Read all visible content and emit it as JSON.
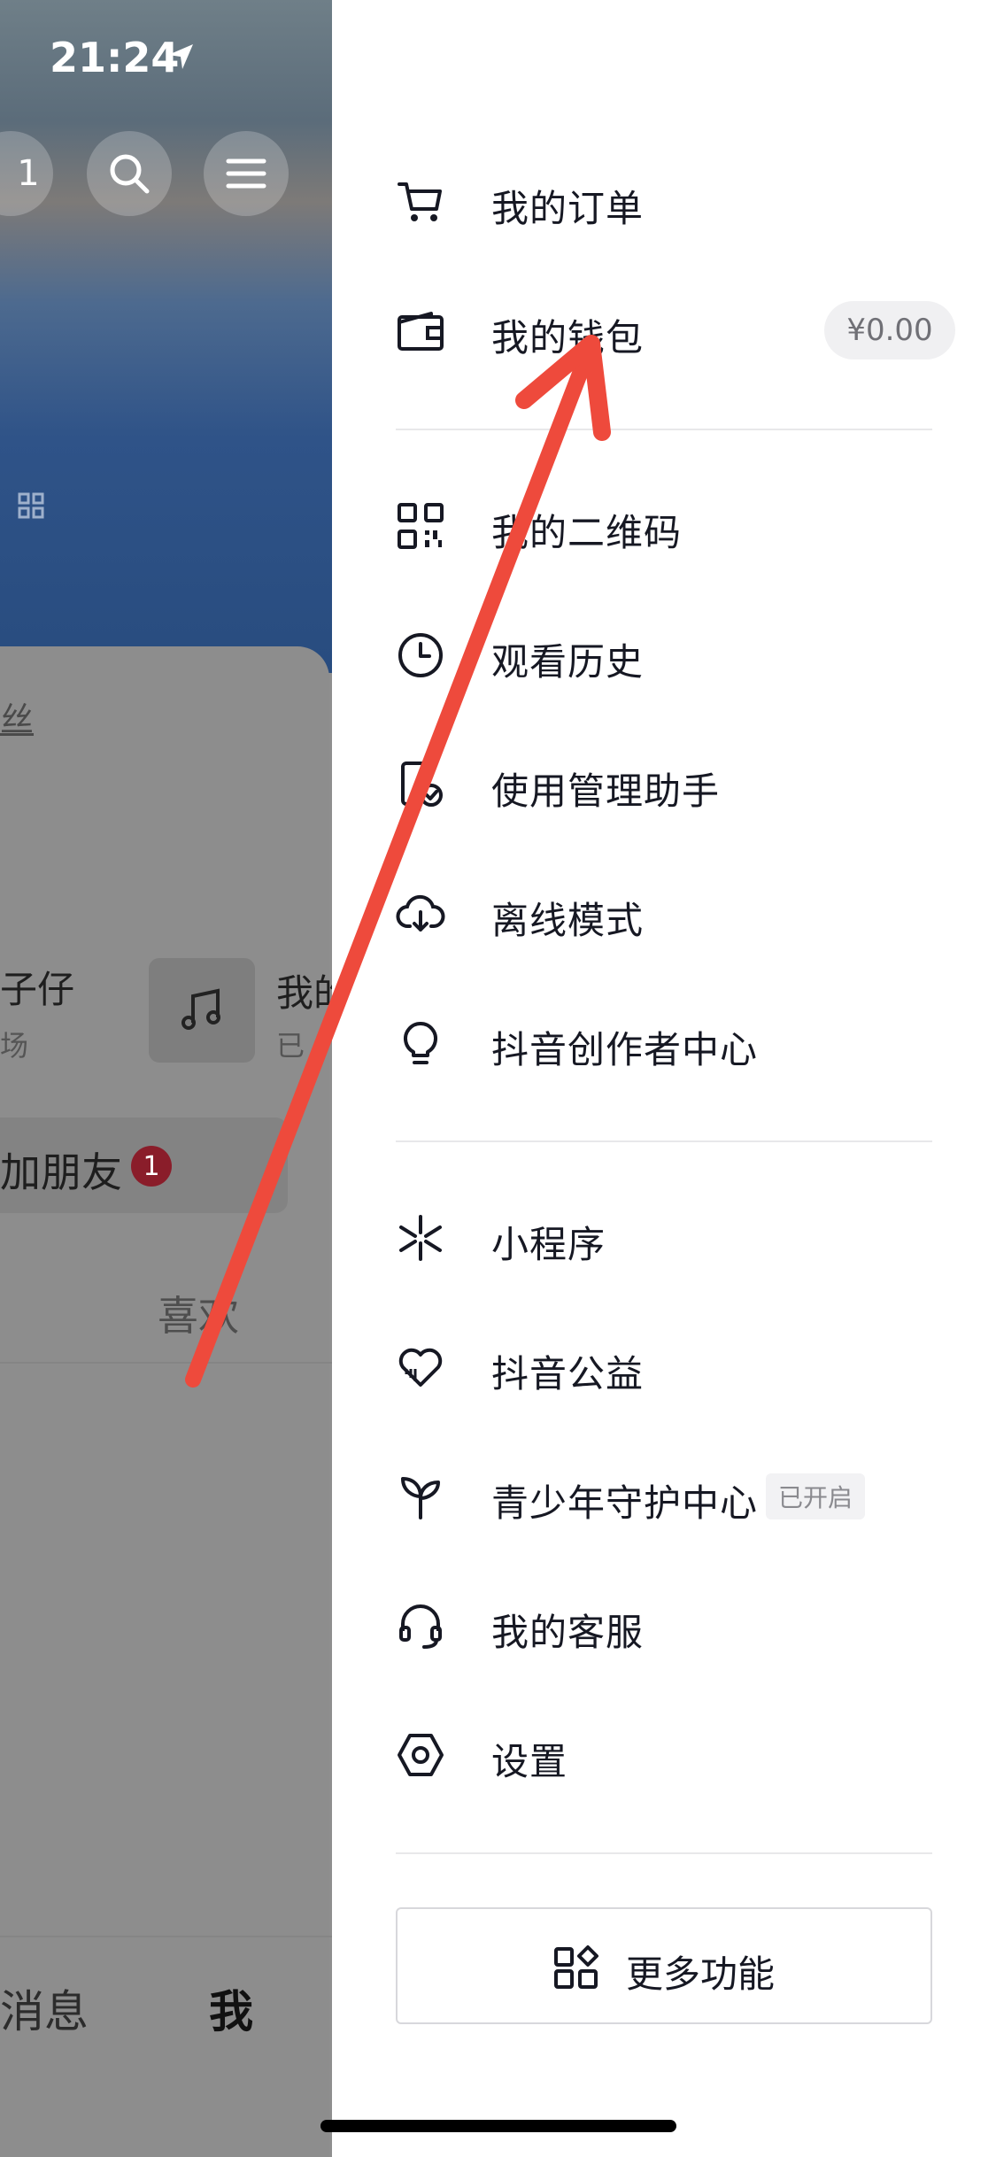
{
  "status_bar": {
    "time": "21:24"
  },
  "background_page": {
    "header_count": "1",
    "fans_label": "丝",
    "item1_title": "子仔",
    "item1_sub": "场",
    "item2_title": "我的",
    "item2_sub": "已",
    "add_friend_label": "加朋友",
    "add_friend_badge": "1",
    "likes_tab": "喜欢",
    "nav_messages": "消息",
    "nav_me": "我"
  },
  "drawer": {
    "items": [
      {
        "label": "我的订单",
        "icon": "cart-icon"
      },
      {
        "label": "我的钱包",
        "icon": "wallet-icon",
        "badge": "¥0.00"
      },
      {
        "label": "我的二维码",
        "icon": "qr-code-icon"
      },
      {
        "label": "观看历史",
        "icon": "clock-icon"
      },
      {
        "label": "使用管理助手",
        "icon": "phone-check-icon"
      },
      {
        "label": "离线模式",
        "icon": "cloud-download-icon"
      },
      {
        "label": "抖音创作者中心",
        "icon": "lightbulb-icon"
      },
      {
        "label": "小程序",
        "icon": "mini-program-icon"
      },
      {
        "label": "抖音公益",
        "icon": "heart-charity-icon"
      },
      {
        "label": "青少年守护中心",
        "icon": "sprout-icon",
        "status": "已开启"
      },
      {
        "label": "我的客服",
        "icon": "headset-icon"
      },
      {
        "label": "设置",
        "icon": "settings-hexagon-icon"
      }
    ],
    "more_button": {
      "label": "更多功能",
      "icon": "apps-grid-icon"
    }
  },
  "colors": {
    "drawer_bg": "#ffffff",
    "text_primary": "#161823",
    "annotation_arrow": "#ee4a3c",
    "overlay_dim": "#8d8d8d"
  }
}
